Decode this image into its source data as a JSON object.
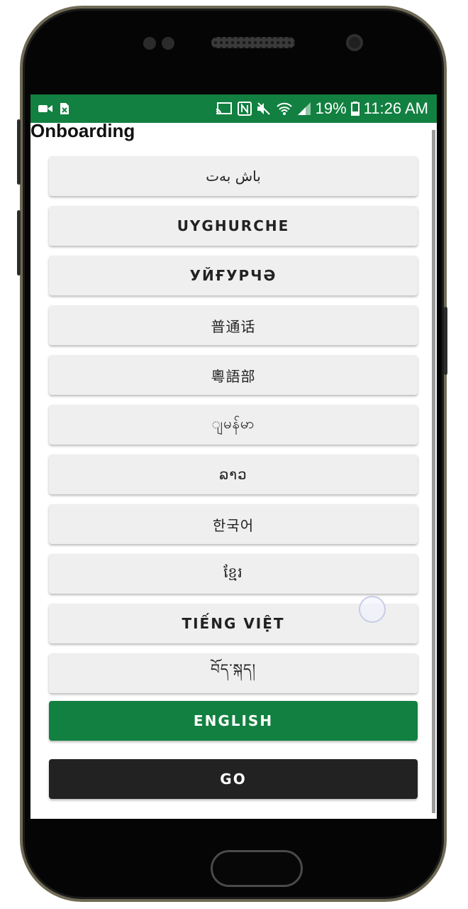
{
  "status_bar": {
    "battery": "19%",
    "time": "11:26 AM",
    "left_icons": [
      "video-camera-icon",
      "sim-error-icon"
    ],
    "right_icons": [
      "cast-icon",
      "nfc-icon",
      "mute-icon",
      "wifi-icon",
      "signal-icon",
      "battery-icon"
    ]
  },
  "app_title": "Onboarding",
  "languages": [
    {
      "label": "باش بەت"
    },
    {
      "label": "UYGHURCHE"
    },
    {
      "label": "УЙҒУРЧӘ"
    },
    {
      "label": "普通话"
    },
    {
      "label": "粵語部"
    },
    {
      "label": "ျမန်မာ"
    },
    {
      "label": "ລາວ"
    },
    {
      "label": "한국어"
    },
    {
      "label": "ខ្មែរ"
    },
    {
      "label": "TIẾNG VIỆT"
    },
    {
      "label": "བོད་སྐད།"
    }
  ],
  "english_label": "ENGLISH",
  "go_label": "GO",
  "colors": {
    "accent": "#128040",
    "dark_button": "#222222",
    "button_bg": "#efefef"
  }
}
